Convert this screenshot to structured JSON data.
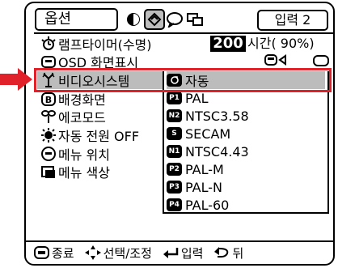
{
  "header": {
    "title": "옵션",
    "input_label": "입력 2"
  },
  "rows": {
    "lamp": {
      "label": "램프타이머(수명)",
      "value": "200",
      "unit": "시간( 90%)"
    },
    "osd": {
      "label": "OSD 화면표시"
    },
    "video": {
      "label": "비디오시스템"
    },
    "background": {
      "label": "배경화면"
    },
    "eco": {
      "label": "에코모드"
    },
    "auto_power": {
      "label": "자동 전원 OFF"
    },
    "menu_pos": {
      "label": "메뉴 위치"
    },
    "menu_color": {
      "label": "메뉴 색상"
    }
  },
  "video_options": [
    {
      "badge": "",
      "label": "자동",
      "selected": true
    },
    {
      "badge": "P1",
      "label": "PAL"
    },
    {
      "badge": "N2",
      "label": "NTSC3.58"
    },
    {
      "badge": "S",
      "label": "SECAM"
    },
    {
      "badge": "N1",
      "label": "NTSC4.43"
    },
    {
      "badge": "P2",
      "label": "PAL-M"
    },
    {
      "badge": "P3",
      "label": "PAL-N"
    },
    {
      "badge": "P4",
      "label": "PAL-60"
    }
  ],
  "footer": {
    "exit": "종료",
    "select": "선택/조정",
    "enter": "입력",
    "back": "뒤"
  },
  "colors": {
    "highlight_border": "#e0212a",
    "selected_fill": "#bcbcbc"
  }
}
